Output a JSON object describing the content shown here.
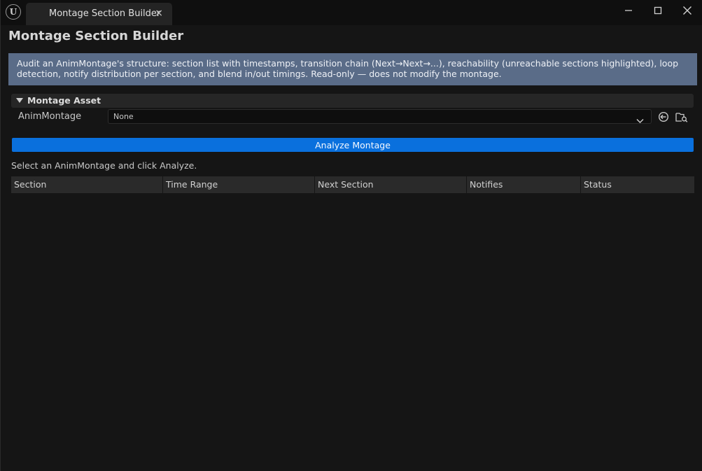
{
  "window": {
    "logo_text": "U",
    "tab_title": "Montage Section Builder",
    "tab_close": "×"
  },
  "panel": {
    "title": "Montage Section Builder",
    "description": "Audit an AnimMontage's structure: section list with timestamps, transition chain (Next→Next→...), reachability (unreachable sections highlighted), loop detection, notify distribution per section, and blend in/out timings. Read-only — does not modify the montage."
  },
  "category": {
    "label": "Montage Asset"
  },
  "property": {
    "label": "AnimMontage",
    "value": "None"
  },
  "actions": {
    "analyze_label": "Analyze Montage"
  },
  "status": {
    "message": "Select an AnimMontage and click Analyze."
  },
  "table": {
    "columns": [
      "Section",
      "Time Range",
      "Next Section",
      "Notifies",
      "Status"
    ]
  },
  "colors": {
    "accent_button": "#0a70dd",
    "info_box": "#5a6c88",
    "background": "#151515"
  },
  "icons": {
    "window_controls": [
      "minimize-icon",
      "maximize-icon",
      "close-icon"
    ],
    "asset_actions": [
      "use-selected-icon",
      "browse-asset-icon"
    ]
  }
}
